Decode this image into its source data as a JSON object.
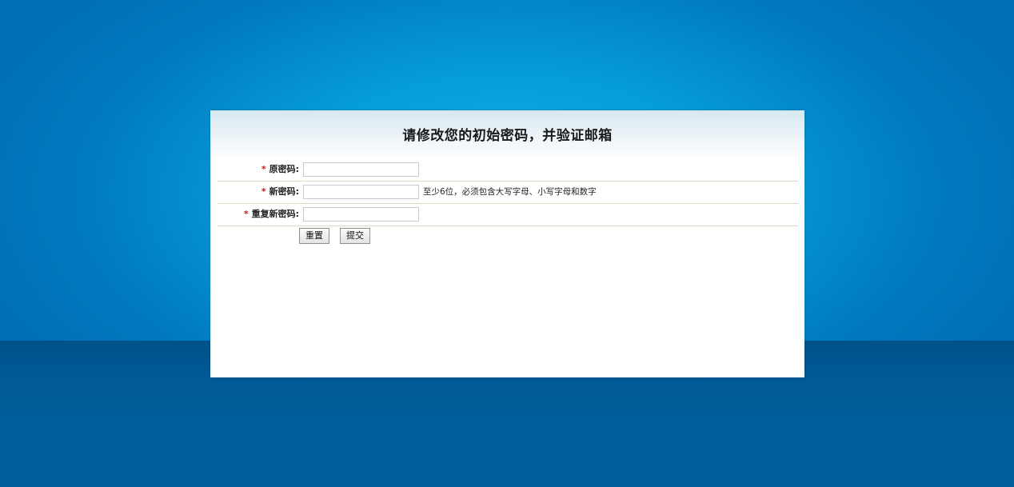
{
  "form": {
    "title": "请修改您的初始密码，并验证邮箱",
    "required_mark": "*",
    "fields": [
      {
        "label": "原密码:",
        "value": "",
        "placeholder": "",
        "hint": ""
      },
      {
        "label": "新密码:",
        "value": "",
        "placeholder": "",
        "hint": "至少6位，必须包含大写字母、小写字母和数字"
      },
      {
        "label": "重复新密码:",
        "value": "",
        "placeholder": "",
        "hint": ""
      }
    ],
    "buttons": {
      "reset_label": "重置",
      "submit_label": "提交"
    }
  },
  "colors": {
    "page_background_upper": "#069bd9",
    "page_background_lower": "#005e9d",
    "panel_background": "#ffffff",
    "required_mark": "#e01010",
    "row_divider": "#dcdcc4"
  }
}
